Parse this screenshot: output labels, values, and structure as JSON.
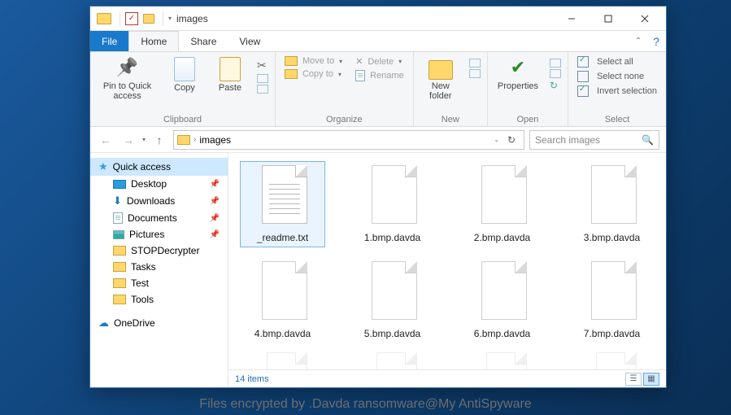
{
  "window": {
    "title": "images",
    "tabs": {
      "file": "File",
      "home": "Home",
      "share": "Share",
      "view": "View"
    }
  },
  "ribbon": {
    "clipboard": {
      "label": "Clipboard",
      "pin": "Pin to Quick access",
      "copy": "Copy",
      "paste": "Paste"
    },
    "organize": {
      "label": "Organize",
      "move": "Move to",
      "copy": "Copy to",
      "delete": "Delete",
      "rename": "Rename"
    },
    "new": {
      "label": "New",
      "newfolder": "New folder"
    },
    "open": {
      "label": "Open",
      "properties": "Properties"
    },
    "select": {
      "label": "Select",
      "all": "Select all",
      "none": "Select none",
      "invert": "Invert selection"
    }
  },
  "navbar": {
    "breadcrumb": "images",
    "search_placeholder": "Search images"
  },
  "sidebar": {
    "quick_access": "Quick access",
    "desktop": "Desktop",
    "downloads": "Downloads",
    "documents": "Documents",
    "pictures": "Pictures",
    "stopdecrypter": "STOPDecrypter",
    "tasks": "Tasks",
    "test": "Test",
    "tools": "Tools",
    "onedrive": "OneDrive"
  },
  "files": {
    "f0": "_readme.txt",
    "f1": "1.bmp.davda",
    "f2": "2.bmp.davda",
    "f3": "3.bmp.davda",
    "f4": "4.bmp.davda",
    "f5": "5.bmp.davda",
    "f6": "6.bmp.davda",
    "f7": "7.bmp.davda"
  },
  "status": {
    "count": "14 items"
  },
  "caption": "Files encrypted by .Davda ransomware@My AntiSpyware"
}
